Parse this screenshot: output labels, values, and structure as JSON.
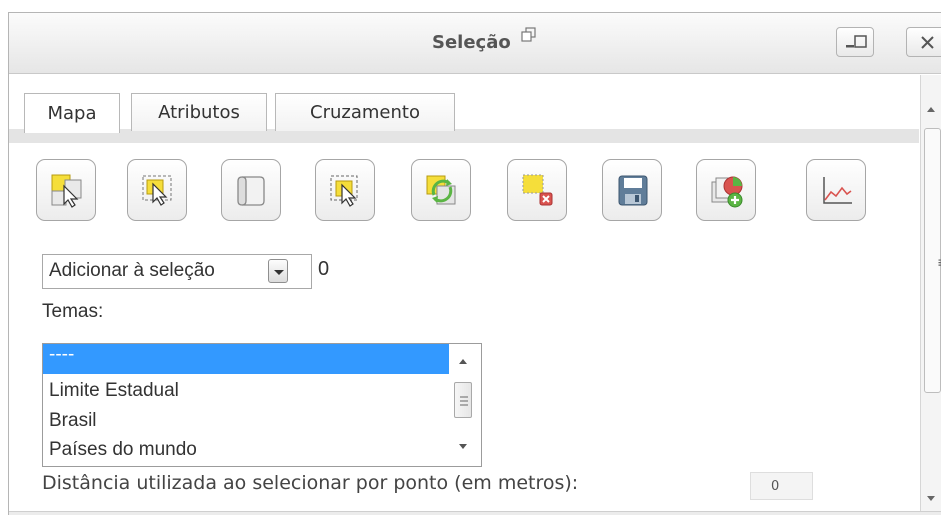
{
  "window": {
    "title": "Seleção"
  },
  "tabs": [
    {
      "label": "Mapa",
      "active": true
    },
    {
      "label": "Atributos",
      "active": false
    },
    {
      "label": "Cruzamento",
      "active": false
    }
  ],
  "toolbar": [
    {
      "icon": "select-by-point-icon"
    },
    {
      "icon": "select-by-box-icon"
    },
    {
      "icon": "clear-selection-icon"
    },
    {
      "icon": "select-by-polygon-icon"
    },
    {
      "icon": "invert-selection-icon"
    },
    {
      "icon": "delete-selection-icon"
    },
    {
      "icon": "save-selection-icon"
    },
    {
      "icon": "add-theme-icon"
    },
    {
      "icon": "chart-icon"
    }
  ],
  "selection_mode": {
    "value": "Adicionar à seleção",
    "count": "0"
  },
  "themes": {
    "label": "Temas:",
    "items": [
      "----",
      "Limite Estadual",
      "Brasil",
      "Países do mundo"
    ],
    "selected_index": 0
  },
  "distance": {
    "label": "Distância utilizada ao selecionar por ponto (em metros):",
    "value": "0"
  },
  "colors": {
    "selection_highlight": "#3399ff",
    "tab_strip": "#e4e4e4",
    "icon_yellow": "#f5de3a",
    "icon_green": "#5bb544",
    "icon_red": "#d9534f"
  }
}
